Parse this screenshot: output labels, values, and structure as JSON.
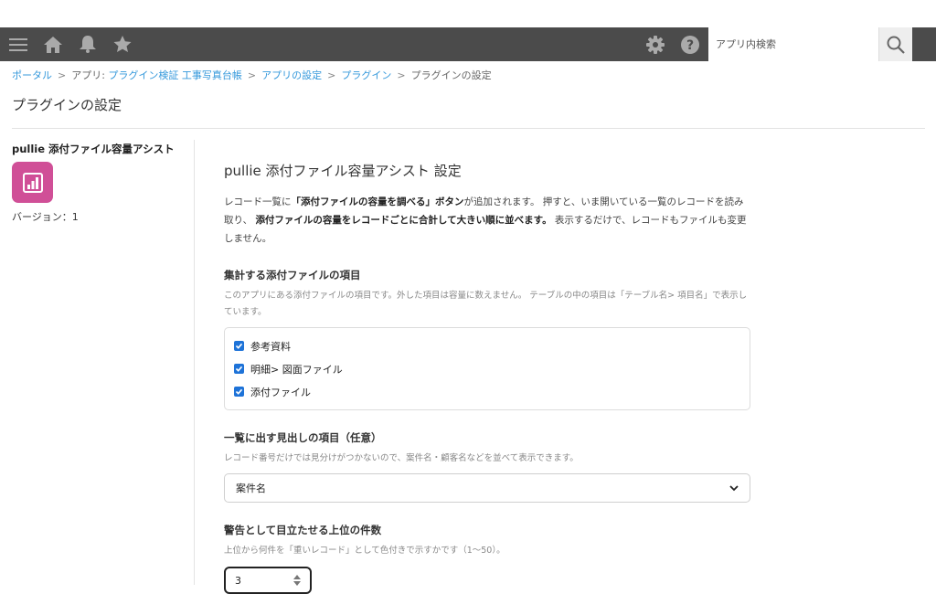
{
  "header": {
    "search_placeholder": "アプリ内検索",
    "icons": [
      "menu-icon",
      "home-icon",
      "bell-icon",
      "star-icon",
      "gear-icon",
      "help-icon",
      "search-icon"
    ],
    "bg_color": "#4b4b4b"
  },
  "breadcrumb": {
    "portal": "ポータル",
    "app_prefix": "アプリ: ",
    "app_name": "プラグイン検証 工事写真台帳",
    "app_settings": "アプリの設定",
    "plugins": "プラグイン",
    "current": "プラグインの設定",
    "separator": ">"
  },
  "page": {
    "title": "プラグインの設定"
  },
  "sidebar": {
    "plugin_name": "pullie 添付ファイル容量アシスト",
    "version": "バージョン：1",
    "icon_color": "#d04f97"
  },
  "content": {
    "title": "pullie 添付ファイル容量アシスト 設定",
    "desc_1": "レコード一覧に",
    "desc_2": "「添付ファイルの容量を調べる」ボタン",
    "desc_3": "が追加されます。 押すと、いま開いている一覧のレコードを読み取り、",
    "desc_4": "添付ファイルの容量をレコードごとに合計して大きい順に並べます。",
    "desc_5": "表示するだけで、レコードもファイルも変更しません。",
    "section1": {
      "label": "集計する添付ファイルの項目",
      "help": "このアプリにある添付ファイルの項目です。外した項目は容量に数えません。 テーブルの中の項目は「テーブル名> 項目名」で表示しています。",
      "items": [
        {
          "label": "参考資料",
          "checked": true
        },
        {
          "label": "明細> 図面ファイル",
          "checked": true
        },
        {
          "label": "添付ファイル",
          "checked": true
        }
      ]
    },
    "section2": {
      "label": "一覧に出す見出しの項目（任意）",
      "help": "レコード番号だけでは見分けがつかないので、案件名・顧客名などを並べて表示できます。",
      "selected": "案件名"
    },
    "section3": {
      "label": "警告として目立たせる上位の件数",
      "help": "上位から何件を「重いレコード」として色付きで示すかです（1〜50）。",
      "value": "3"
    },
    "accent_color": "#1e73d8"
  }
}
